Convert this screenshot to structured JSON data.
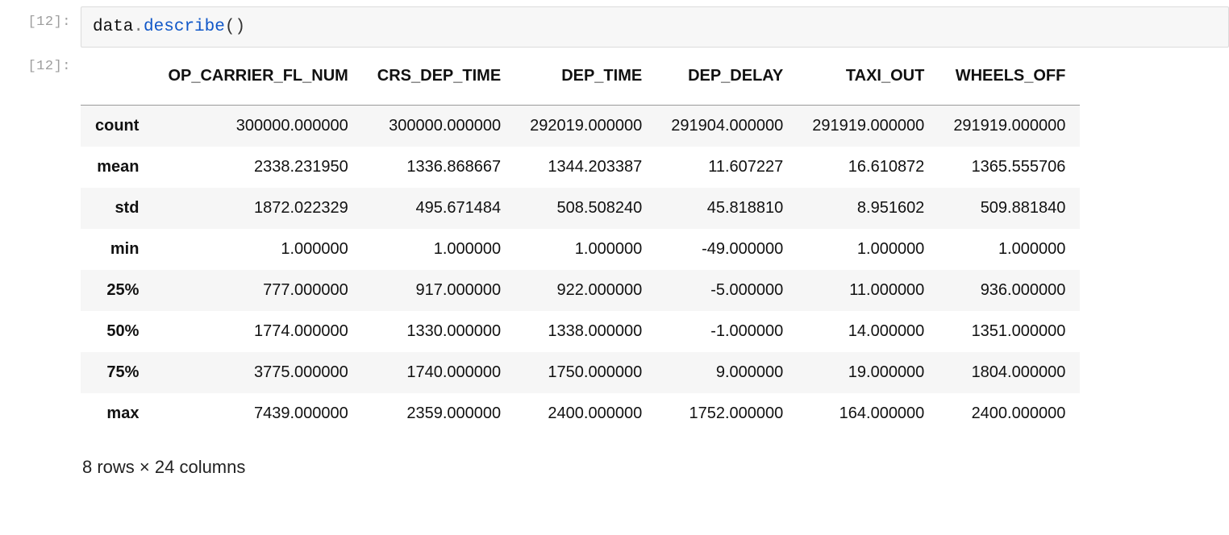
{
  "input_cell": {
    "prompt_label": "[12]:",
    "code_var": "data",
    "code_dot": ".",
    "code_method": "describe",
    "code_parens": "()"
  },
  "output_cell": {
    "prompt_label": "[12]:",
    "columns": [
      "OP_CARRIER_FL_NUM",
      "CRS_DEP_TIME",
      "DEP_TIME",
      "DEP_DELAY",
      "TAXI_OUT",
      "WHEELS_OFF"
    ],
    "index": [
      "count",
      "mean",
      "std",
      "min",
      "25%",
      "50%",
      "75%",
      "max"
    ],
    "rows": [
      [
        "300000.000000",
        "300000.000000",
        "292019.000000",
        "291904.000000",
        "291919.000000",
        "291919.000000"
      ],
      [
        "2338.231950",
        "1336.868667",
        "1344.203387",
        "11.607227",
        "16.610872",
        "1365.555706"
      ],
      [
        "1872.022329",
        "495.671484",
        "508.508240",
        "45.818810",
        "8.951602",
        "509.881840"
      ],
      [
        "1.000000",
        "1.000000",
        "1.000000",
        "-49.000000",
        "1.000000",
        "1.000000"
      ],
      [
        "777.000000",
        "917.000000",
        "922.000000",
        "-5.000000",
        "11.000000",
        "936.000000"
      ],
      [
        "1774.000000",
        "1330.000000",
        "1338.000000",
        "-1.000000",
        "14.000000",
        "1351.000000"
      ],
      [
        "3775.000000",
        "1740.000000",
        "1750.000000",
        "9.000000",
        "19.000000",
        "1804.000000"
      ],
      [
        "7439.000000",
        "2359.000000",
        "2400.000000",
        "1752.000000",
        "164.000000",
        "2400.000000"
      ]
    ],
    "shape_note": "8 rows × 24 columns"
  }
}
